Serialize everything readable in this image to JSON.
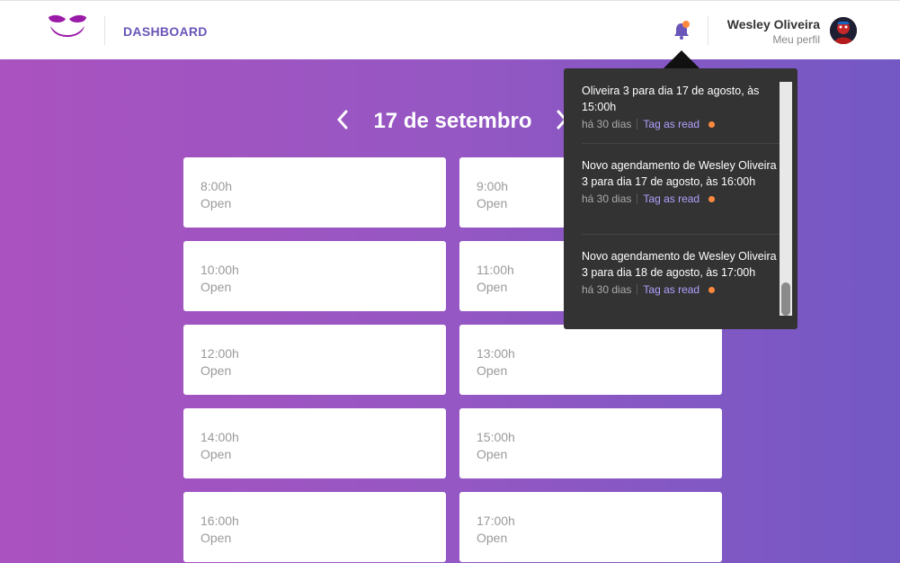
{
  "header": {
    "logo_icon": "mustache-logo-icon",
    "nav_label": "DASHBOARD",
    "notifications_icon": "bell-icon",
    "user": {
      "name": "Wesley Oliveira",
      "profile_link": "Meu perfil"
    }
  },
  "schedule": {
    "date_label": "17 de setembro",
    "prev_icon": "chevron-left-icon",
    "next_icon": "chevron-right-icon",
    "slots": [
      {
        "time": "8:00h",
        "status": "Open"
      },
      {
        "time": "9:00h",
        "status": "Open"
      },
      {
        "time": "10:00h",
        "status": "Open"
      },
      {
        "time": "11:00h",
        "status": "Open"
      },
      {
        "time": "12:00h",
        "status": "Open"
      },
      {
        "time": "13:00h",
        "status": "Open"
      },
      {
        "time": "14:00h",
        "status": "Open"
      },
      {
        "time": "15:00h",
        "status": "Open"
      },
      {
        "time": "16:00h",
        "status": "Open"
      },
      {
        "time": "17:00h",
        "status": "Open"
      }
    ]
  },
  "notifications": {
    "items": [
      {
        "message": "Oliveira 3 para dia 17 de agosto, às 15:00h",
        "ago": "há 30 dias",
        "action": "Tag as read"
      },
      {
        "message": "Novo agendamento de Wesley Oliveira 3 para dia 17 de agosto, às 16:00h",
        "ago": "há 30 dias",
        "action": "Tag as read"
      },
      {
        "message": "Novo agendamento de Wesley Oliveira 3 para dia 18 de agosto, às 17:00h",
        "ago": "há 30 dias",
        "action": "Tag as read"
      }
    ]
  },
  "colors": {
    "brand_purple": "#9a1aa8",
    "accent": "#6a55b8",
    "gradient_start": "#aa52c0",
    "gradient_end": "#7358c4",
    "unread_dot": "#ff8a3d",
    "popup_bg": "#333333",
    "link": "#b3a0ff"
  }
}
